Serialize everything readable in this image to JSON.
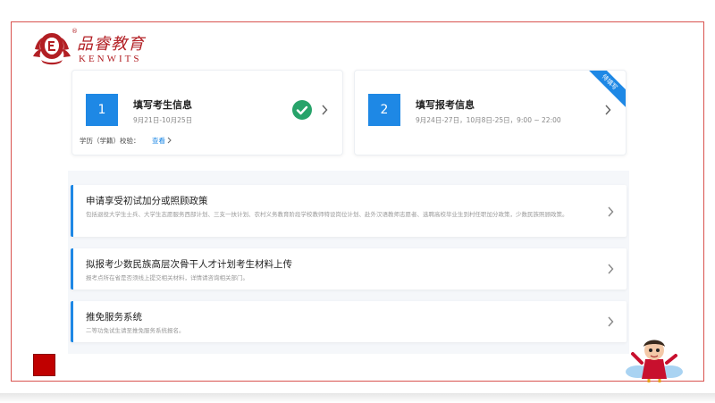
{
  "brand": {
    "name_cn": "品睿教育",
    "name_en": "KENWITS",
    "reg_mark": "®",
    "color": "#b21f24"
  },
  "steps": [
    {
      "number": "1",
      "title": "填写考生信息",
      "date": "9月21日-10月25日",
      "status": "completed",
      "verify_label": "学历（学籍）校验：",
      "verify_link": "查看"
    },
    {
      "number": "2",
      "title": "填写报考信息",
      "date": "9月24日-27日，10月8日-25日，9:00 ~ 22:00",
      "badge": "待填写"
    }
  ],
  "policies": [
    {
      "title": "申请享受初试加分或照顾政策",
      "desc": "包括退役大学生士兵、大学生志愿服务西部计划、三支一扶计划、农村义务教育阶段学校教师特设岗位计划、赴外汉语教师志愿者、选聘高校毕业生到村任职加分政策，少数民族照顾政策。"
    },
    {
      "title": "拟报考少数民族高层次骨干人才计划考生材料上传",
      "desc": "报考点所在省是否须线上提交相关材料，详情请咨询相关部门。"
    },
    {
      "title": "推免服务系统",
      "desc": "二等功免试生请至推免服务系统报名。"
    }
  ],
  "colors": {
    "accent": "#1e88e5",
    "success": "#27a36a",
    "frame_border": "#d9534f",
    "panel_bg": "#f5f7fa"
  }
}
